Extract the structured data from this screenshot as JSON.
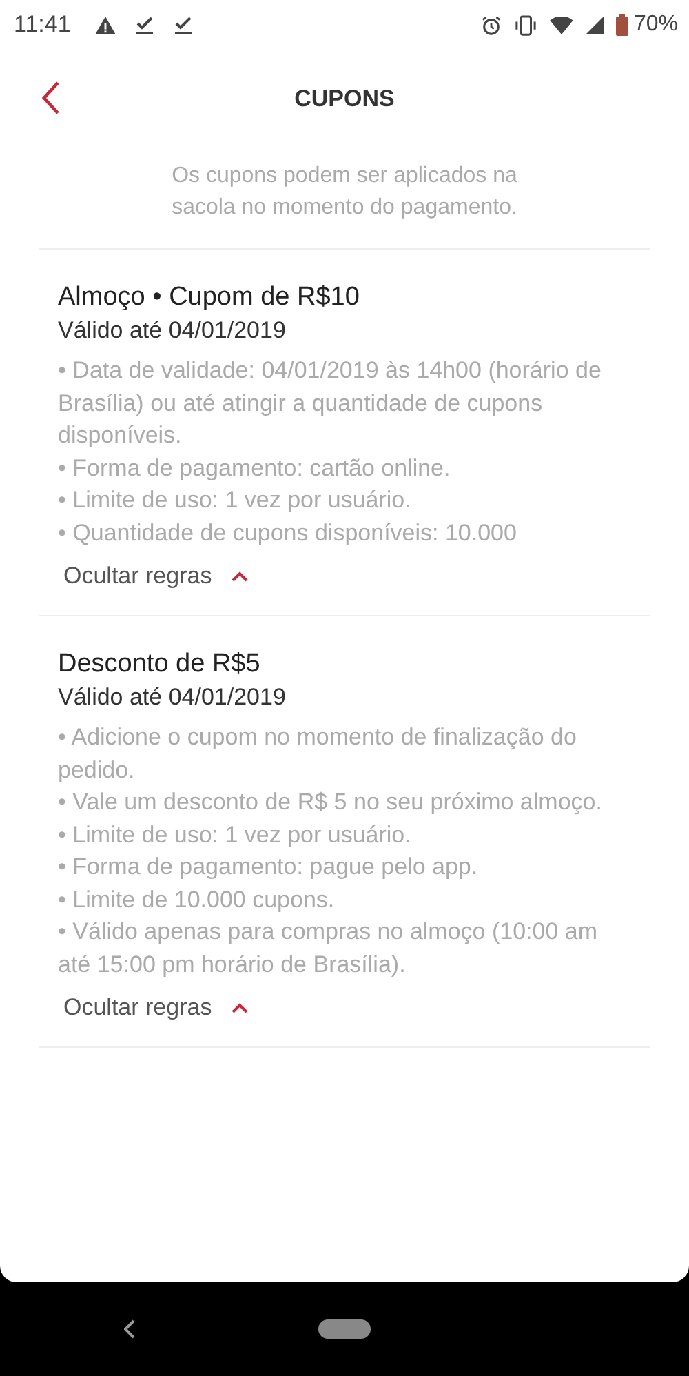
{
  "status_bar": {
    "time": "11:41",
    "battery": "70%"
  },
  "header": {
    "title": "CUPONS"
  },
  "intro": "Os cupons podem ser aplicados na sacola no momento do pagamento.",
  "coupons": [
    {
      "title": "Almoço • Cupom de R$10",
      "validity": "Válido até 04/01/2019",
      "expanded": true,
      "rules": [
        "• Data de validade: 04/01/2019 às 14h00 (horário de Brasília) ou até atingir a quantidade de cupons disponíveis.",
        "• Forma de pagamento: cartão online.",
        "• Limite de uso: 1 vez por usuário.",
        "• Quantidade de cupons disponíveis: 10.000"
      ],
      "toggle": "Ocultar regras"
    },
    {
      "title": "Desconto de R$5",
      "validity": "Válido até 04/01/2019",
      "expanded": true,
      "rules": [
        "• Adicione o cupom no momento de finalização do pedido.",
        "• Vale um desconto de R$ 5 no seu próximo almoço.",
        "• Limite de uso: 1 vez por usuário.",
        "• Forma de pagamento: pague pelo app.",
        "• Limite de 10.000 cupons.",
        "• Válido apenas para compras no almoço (10:00 am até 15:00 pm horário de Brasília)."
      ],
      "toggle": "Ocultar regras"
    }
  ]
}
